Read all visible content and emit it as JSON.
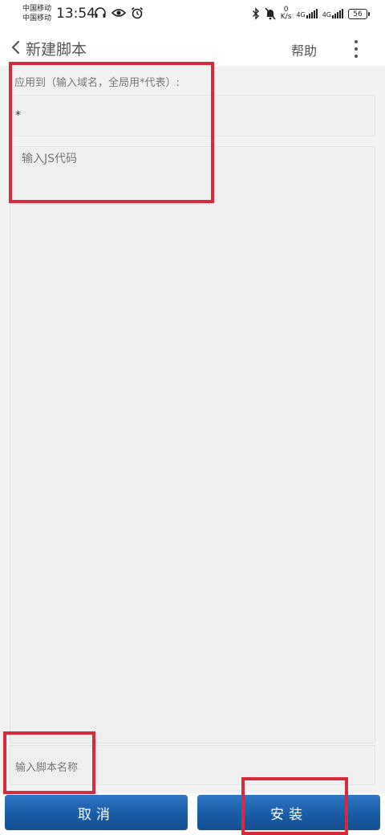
{
  "status_bar": {
    "carrier_1": "中国移动",
    "carrier_2": "中国移动",
    "time": "13:54",
    "speed_value": "0",
    "speed_unit": "K/s",
    "signal_1": "4G",
    "signal_2": "4G",
    "battery": "56"
  },
  "header": {
    "title": "新建脚本",
    "help_label": "帮助"
  },
  "form": {
    "apply_label": "应用到（输入域名，全局用*代表）:",
    "domain_value": "*",
    "code_placeholder": "输入JS代码",
    "name_placeholder": "输入脚本名称"
  },
  "buttons": {
    "cancel": "取消",
    "install": "安装"
  },
  "colors": {
    "button_blue": "#1a5ca6",
    "annotation_red": "#d82a3a"
  }
}
